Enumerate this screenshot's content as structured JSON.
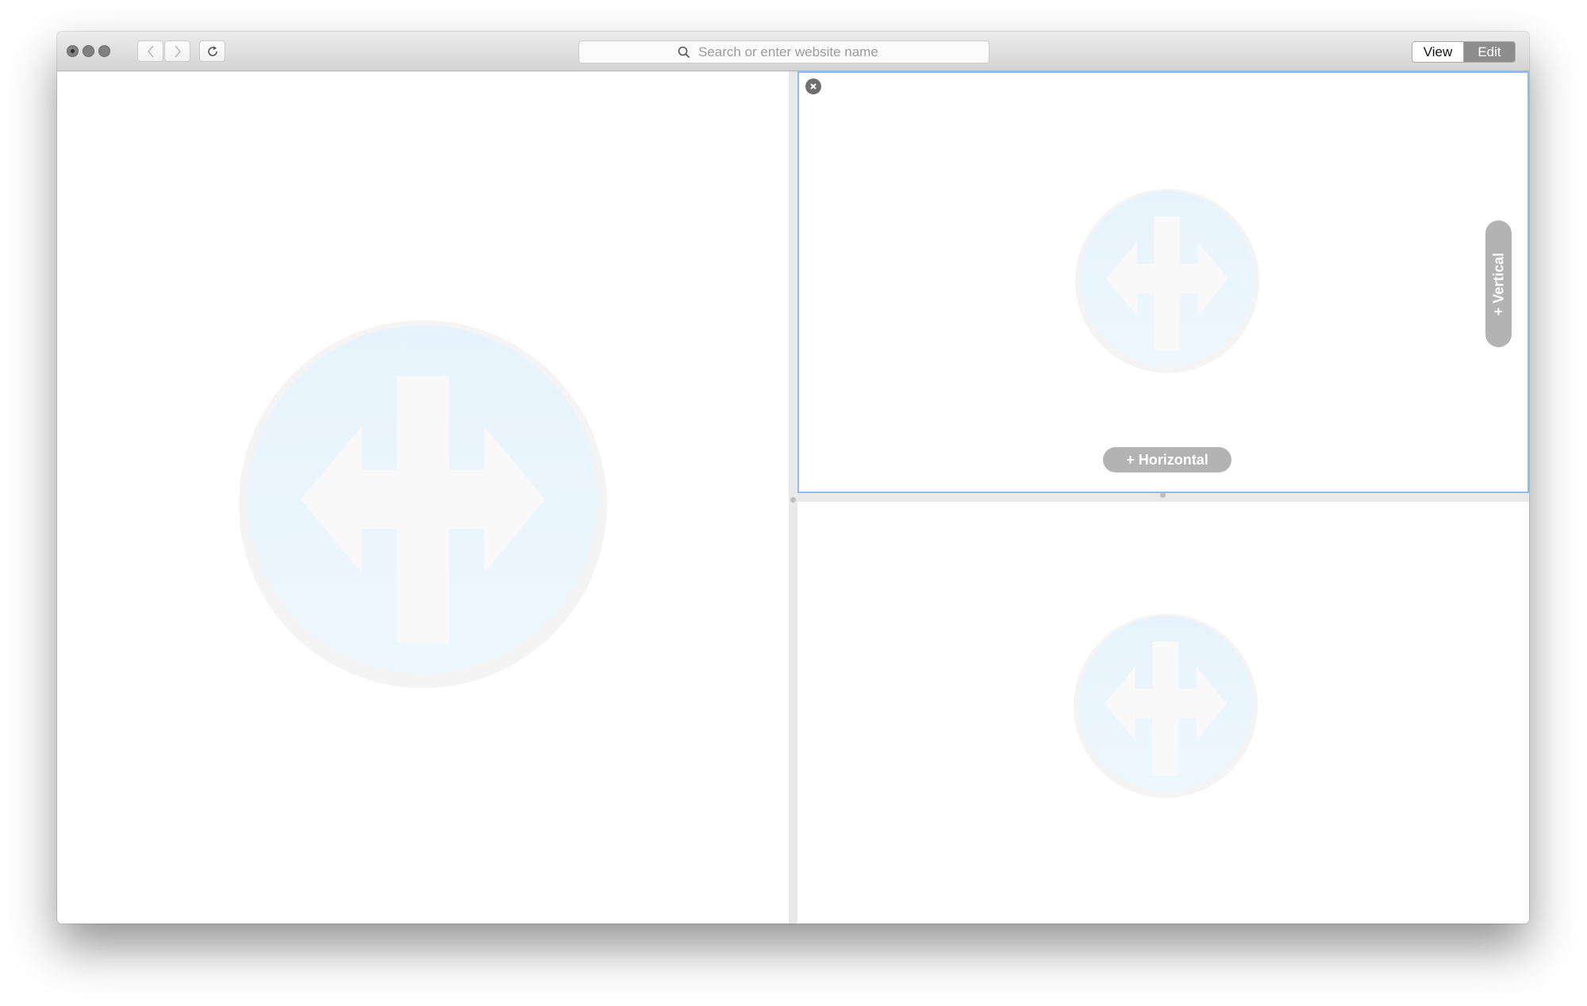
{
  "toolbar": {
    "back_icon": "chevron-left-icon",
    "forward_icon": "chevron-right-icon",
    "reload_icon": "reload-icon",
    "search": {
      "placeholder": "Search or enter website name",
      "value": ""
    },
    "mode_tabs": {
      "view_label": "View",
      "edit_label": "Edit",
      "selected": "Edit"
    }
  },
  "panes": {
    "top_right": {
      "vertical_label": "+ Vertical",
      "horizontal_label": "+ Horizontal"
    }
  },
  "colors": {
    "selected_pane_border": "#8cbcf0",
    "placeholder_circle": "#e8f4fd",
    "pill": "#b3b3b3"
  }
}
